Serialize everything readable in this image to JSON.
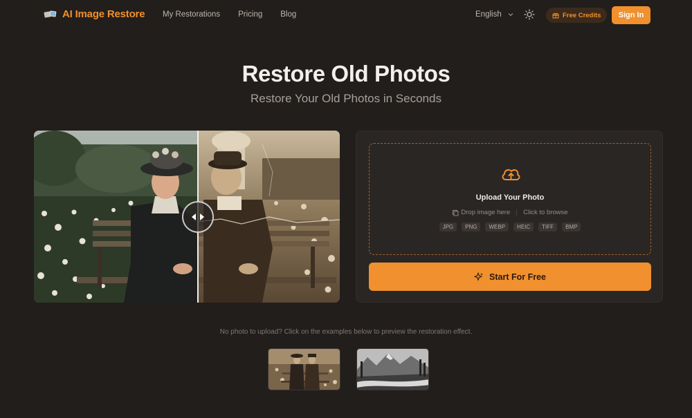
{
  "nav": {
    "logo_text": "AI Image Restore",
    "links": [
      "My Restorations",
      "Pricing",
      "Blog"
    ],
    "language": "English",
    "credits_label": "Free Credits",
    "signin_label": "Sign In"
  },
  "hero": {
    "title": "Restore Old Photos",
    "subtitle": "Restore Your Old Photos in Seconds"
  },
  "upload": {
    "title": "Upload Your Photo",
    "drop_hint": "Drop image here",
    "browse_hint": "Click to browse",
    "formats": [
      "JPG",
      "PNG",
      "WEBP",
      "HEIC",
      "TIFF",
      "BMP"
    ],
    "start_label": "Start For Free"
  },
  "examples": {
    "prompt": "No photo to upload? Click on the examples below to preview the restoration effect."
  },
  "colors": {
    "background": "#221e1c",
    "accent": "#f0902e",
    "card": "#2a2624"
  },
  "icons": {
    "theme": "sun-icon",
    "credits": "gift-icon",
    "upload": "cloud-upload-icon",
    "start": "sparkles-icon",
    "handle": "split-arrows-icon"
  }
}
